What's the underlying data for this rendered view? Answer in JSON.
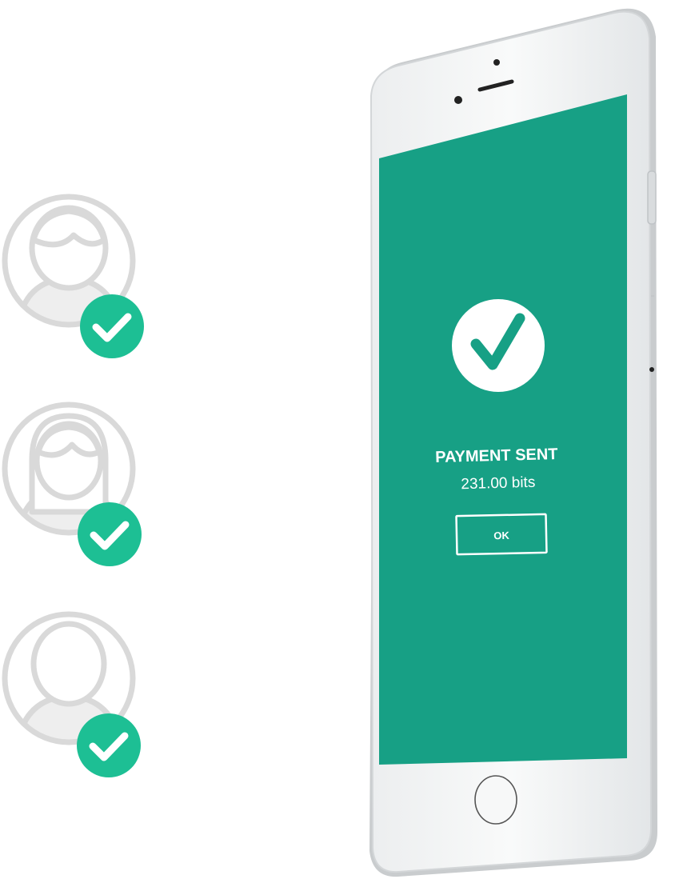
{
  "colors": {
    "screen": "#17a085",
    "badge": "#1dbf94",
    "avatar_outline": "#d9d9d9",
    "avatar_fill": "#eeeeee",
    "phone_body": "#f4f5f5",
    "phone_edge": "#c9ccce",
    "white": "#ffffff"
  },
  "icons": {
    "avatars": [
      "woman-short-hair-avatar-icon",
      "woman-long-hair-avatar-icon",
      "man-avatar-icon"
    ],
    "badge": "checkmark-badge-icon",
    "success": "checkmark-circle-icon",
    "home": "home-button-icon"
  },
  "payment": {
    "title": "PAYMENT SENT",
    "amount": "231.00 bits",
    "ok_label": "OK"
  }
}
